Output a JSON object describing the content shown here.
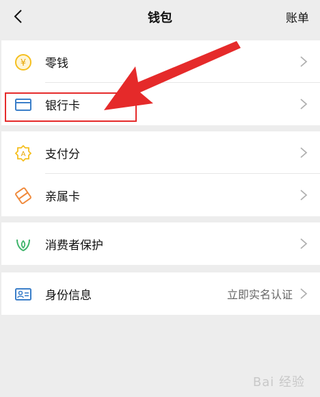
{
  "header": {
    "title": "钱包",
    "right_label": "账单",
    "back_icon": "chevron-left-icon"
  },
  "groups": [
    {
      "items": [
        {
          "label": "零钱",
          "icon": "coin-icon"
        },
        {
          "label": "银行卡",
          "icon": "bank-card-icon"
        }
      ]
    },
    {
      "items": [
        {
          "label": "支付分",
          "icon": "score-badge-icon"
        },
        {
          "label": "亲属卡",
          "icon": "family-card-icon"
        }
      ]
    },
    {
      "items": [
        {
          "label": "消费者保护",
          "icon": "consumer-protection-icon"
        }
      ]
    },
    {
      "items": [
        {
          "label": "身份信息",
          "icon": "id-card-icon",
          "extra": "立即实名认证"
        }
      ]
    }
  ],
  "colors": {
    "background": "#ededed",
    "annotation_red": "#e52a2a",
    "icon_yellow": "#f5bf1e",
    "icon_blue": "#3a7ec9",
    "icon_orange": "#f08a3c",
    "icon_green": "#3fb46b"
  },
  "watermark": "Bai  经验"
}
